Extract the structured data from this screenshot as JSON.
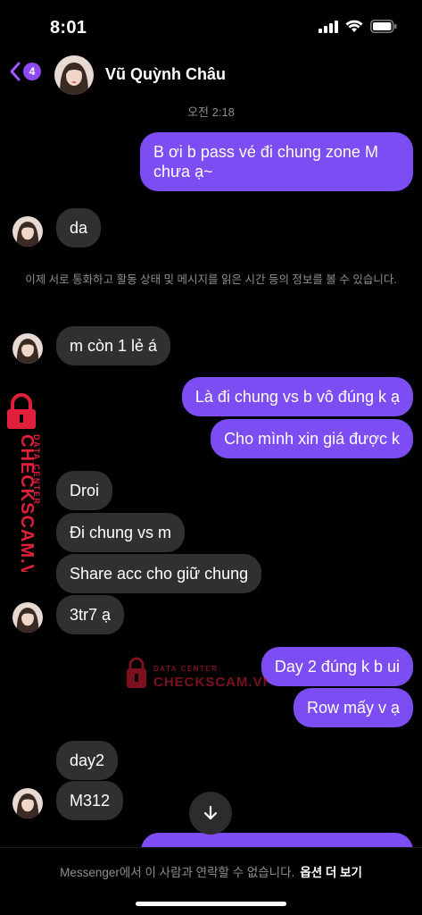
{
  "status_bar": {
    "time": "8:01",
    "icons": [
      "cellular-signal-icon",
      "wifi-icon",
      "battery-icon"
    ]
  },
  "header": {
    "back_badge": "4",
    "contact_name": "Vũ Quỳnh Châu"
  },
  "conversation": {
    "timestamp": "오전 2:18",
    "notice": "이제 서로 통화하고 활동 상태 및 메시지를 읽은 시간 등의 정보를 볼 수 있습니다.",
    "messages": [
      {
        "from": "me",
        "text": "B ơi b pass vé đi chung zone M chưa ạ~"
      },
      {
        "from": "them",
        "text": "da"
      },
      {
        "from": "them",
        "text": "m còn 1 lẻ á"
      },
      {
        "from": "me",
        "text": "Là đi chung vs b vô đúng k ạ"
      },
      {
        "from": "me",
        "text": "Cho mình xin giá được k"
      },
      {
        "from": "them",
        "text": "Droi"
      },
      {
        "from": "them",
        "text": "Đi chung vs m"
      },
      {
        "from": "them",
        "text": "Share acc cho giữ chung"
      },
      {
        "from": "them",
        "text": "3tr7 ạ"
      },
      {
        "from": "me",
        "text": "Day 2 đúng k b ui"
      },
      {
        "from": "me",
        "text": "Row mấy v ạ"
      },
      {
        "from": "them",
        "text": "day2"
      },
      {
        "from": "them",
        "text": "M312"
      }
    ]
  },
  "watermark": {
    "line1": "DATA CENTER",
    "line2": "CHECKSCAM.VN"
  },
  "footer": {
    "text": "Messenger에서 이 사람과 연락할 수 없습니다.",
    "link": "옵션 더 보기"
  },
  "colors": {
    "outgoing_bubble": "#7b4df2",
    "incoming_bubble": "#303030",
    "badge": "#8f4bf5",
    "watermark": "#e0203a"
  }
}
